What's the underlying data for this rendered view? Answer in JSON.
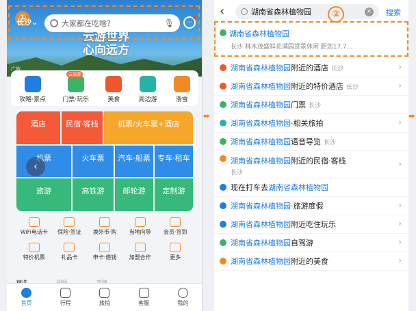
{
  "left": {
    "city": "长沙",
    "step_marker": "①",
    "search_placeholder": "大家都在吃啥？",
    "slogan": [
      "云游世界",
      "心向远方"
    ],
    "ad_label": "广告",
    "quick": [
      {
        "label": "攻略·景点",
        "color": "#1f7ee0"
      },
      {
        "label": "门票·玩乐",
        "color": "#3bb36a",
        "badge": "云旅游"
      },
      {
        "label": "美食",
        "color": "#f0562d"
      },
      {
        "label": "周边游",
        "color": "#27b2a6"
      },
      {
        "label": "滑雪",
        "color": "#f08a24"
      }
    ],
    "grid": {
      "hotel": "酒店",
      "inn": "民宿·客栈",
      "flight": "机票/火车票+酒店",
      "air": "机票",
      "train": "火车票",
      "bus": "汽车·船票",
      "car": "专车·租车",
      "travel": "旅游",
      "rail": "高铁游",
      "cruise": "邮轮游",
      "custom": "定制游"
    },
    "services": [
      "WiFi电话卡",
      "保险·签证",
      "换外币·购",
      "当地向导",
      "会员·签到",
      "特价机票",
      "礼品卡",
      "申卡·借钱",
      "加盟合作",
      "更多"
    ],
    "peek": [
      "精选",
      "视频",
      "攻略"
    ],
    "tabs": [
      "首页",
      "行程",
      "旅拍",
      "客服",
      "我的"
    ]
  },
  "right": {
    "query": "湖南省森林植物园",
    "search_btn": "搜索",
    "step_marker": "②",
    "top": {
      "title": "湖南省森林植物园",
      "sub": "长沙 林木茂盛鲜花满园赏景休闲 距您17.7..."
    },
    "rows": [
      {
        "pre": "",
        "hl": "湖南省森林植物园",
        "post": "附近的酒店",
        "city": "长沙",
        "color": "#f0562d",
        "chev": true
      },
      {
        "pre": "",
        "hl": "湖南省森林植物园",
        "post": "附近的特价酒店",
        "city": "长沙",
        "color": "#f0562d",
        "chev": true
      },
      {
        "pre": "",
        "hl": "湖南省森林植物园",
        "post": "门票",
        "city": "长沙",
        "color": "#3bb36a",
        "chev": false
      },
      {
        "pre": "",
        "hl": "湖南省森林植物园",
        "post": "·相关旅拍",
        "city": "",
        "color": "#27b2a6",
        "chev": true
      },
      {
        "pre": "",
        "hl": "湖南省森林植物园",
        "post": "语音导览",
        "city": "长沙",
        "color": "#3bb36a",
        "chev": false
      },
      {
        "pre": "",
        "hl": "湖南省森林植物园",
        "post": "附近的民宿·客栈",
        "city": "",
        "city2": "长沙",
        "color": "#f08a24",
        "chev": true,
        "tall": true
      },
      {
        "pre": "现在打车去",
        "hl": "湖南省森林植物园",
        "post": "",
        "city": "",
        "color": "#1f7ee0",
        "chev": false
      },
      {
        "pre": "",
        "hl": "湖南省森林植物园",
        "post": "·旅游度假",
        "city": "",
        "color": "#1f7ee0",
        "chev": true
      },
      {
        "pre": "",
        "hl": "湖南省森林植物园",
        "post": "附近吃住玩乐",
        "city": "",
        "color": "#1f7ee0",
        "chev": true
      },
      {
        "pre": "",
        "hl": "湖南省森林植物园",
        "post": "自驾游",
        "city": "",
        "color": "#3bb36a",
        "chev": true
      },
      {
        "pre": "",
        "hl": "湖南省森林植物园",
        "post": "附近的美食",
        "city": "",
        "color": "#f08a24",
        "chev": true
      }
    ]
  }
}
